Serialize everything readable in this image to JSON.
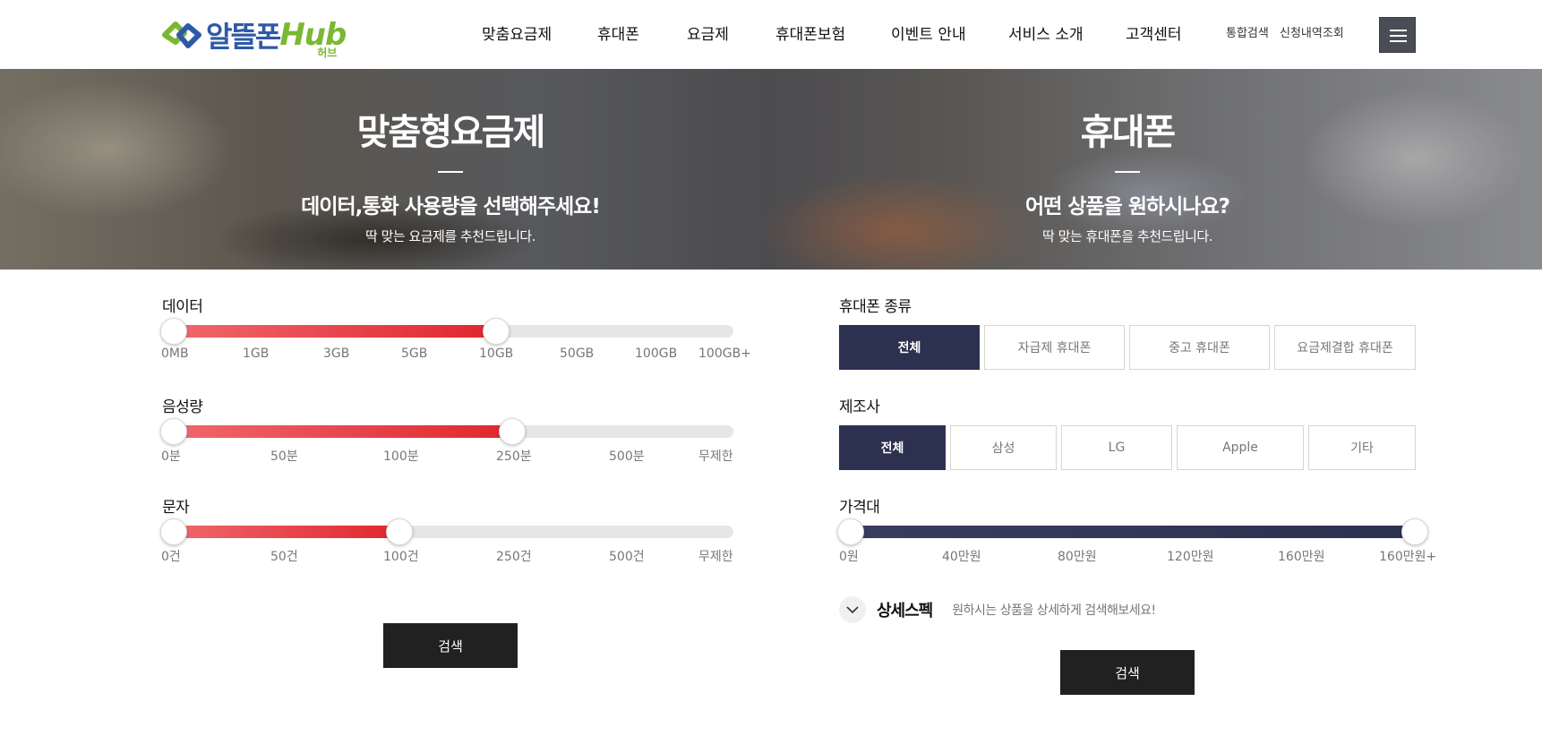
{
  "brand": {
    "logo_text": "알뜰폰",
    "logo_hub": "Hub",
    "logo_sub": "허브"
  },
  "nav": {
    "items": [
      "맞춤요금제",
      "휴대폰",
      "요금제",
      "휴대폰보험",
      "이벤트 안내",
      "서비스 소개",
      "고객센터"
    ],
    "util_links": [
      "통합검색",
      "신청내역조회"
    ]
  },
  "hero": {
    "left": {
      "title": "맞춤형요금제",
      "subtitle": "데이터,통화 사용량을 선택해주세요!",
      "desc": "딱 맞는 요금제를 추천드립니다."
    },
    "right": {
      "title": "휴대폰",
      "subtitle": "어떤 상품을 원하시나요?",
      "desc": "딱 맞는 휴대폰을 추천드립니다."
    }
  },
  "plan": {
    "data": {
      "label": "데이터",
      "ticks": [
        "0MB",
        "1GB",
        "3GB",
        "5GB",
        "10GB",
        "50GB",
        "100GB",
        "100GB+"
      ],
      "selected_from": "0MB",
      "selected_to": "10GB"
    },
    "voice": {
      "label": "음성량",
      "ticks": [
        "0분",
        "50분",
        "100분",
        "250분",
        "500분",
        "무제한"
      ],
      "selected_from": "0분",
      "selected_to": "250분"
    },
    "sms": {
      "label": "문자",
      "ticks": [
        "0건",
        "50건",
        "100건",
        "250건",
        "500건",
        "무제한"
      ],
      "selected_from": "0건",
      "selected_to": "100건"
    },
    "search_label": "검색"
  },
  "phone": {
    "type": {
      "label": "휴대폰 종류",
      "options": [
        "전체",
        "자급제 휴대폰",
        "중고 휴대폰",
        "요금제결합 휴대폰"
      ],
      "selected": "전체"
    },
    "maker": {
      "label": "제조사",
      "options": [
        "전체",
        "삼성",
        "LG",
        "Apple",
        "기타"
      ],
      "selected": "전체"
    },
    "price": {
      "label": "가격대",
      "ticks": [
        "0원",
        "40만원",
        "80만원",
        "120만원",
        "160만원",
        "160만원+"
      ],
      "selected_from": "0원",
      "selected_to": "160만원+"
    },
    "spec": {
      "title": "상세스펙",
      "desc": "원하시는 상품을 상세하게 검색해보세요!"
    },
    "search_label": "검색"
  },
  "colors": {
    "navy": "#2d3150",
    "red": "#e0262e",
    "red_light": "#f06a6f",
    "dark_button": "#212121",
    "logo_blue": "#2f59a8",
    "logo_green": "#7ab833"
  },
  "icons": [
    "logo-mark-icon",
    "hamburger-menu-icon",
    "chevron-down-icon"
  ]
}
